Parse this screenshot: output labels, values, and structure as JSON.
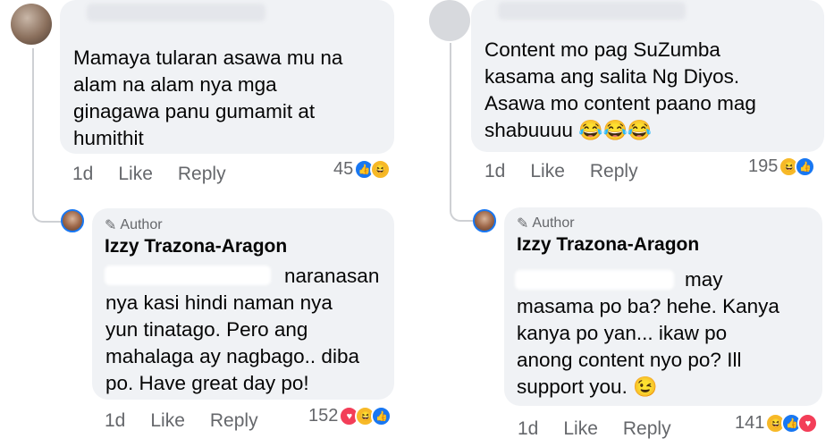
{
  "left": {
    "comment": {
      "lines": [
        "Mamaya tularan asawa mu na",
        "alam na alam nya mga",
        "ginagawa panu gumamit at",
        "humithit"
      ],
      "time": "1d",
      "like_label": "Like",
      "reply_label": "Reply",
      "reaction_count": "45"
    },
    "reply": {
      "badge": "Author",
      "name": "Izzy Trazona-Aragon",
      "lines": [
        "naranasan",
        "nya kasi hindi naman nya",
        "yun tinatago. Pero ang",
        "mahalaga ay nagbago.. diba",
        "po. Have great day po!"
      ],
      "time": "1d",
      "like_label": "Like",
      "reply_label": "Reply",
      "reaction_count": "152"
    }
  },
  "right": {
    "comment": {
      "lines": [
        "Content mo pag SuZumba",
        "kasama ang salita Ng Diyos.",
        "Asawa mo content paano mag",
        "shabuuuu"
      ],
      "emoji": "😂😂😂",
      "time": "1d",
      "like_label": "Like",
      "reply_label": "Reply",
      "reaction_count": "195"
    },
    "reply": {
      "badge": "Author",
      "name": "Izzy Trazona-Aragon",
      "lines": [
        "may",
        "masama po ba? hehe. Kanya",
        "kanya po yan... ikaw po",
        "anong content nyo po? Ill",
        "support you."
      ],
      "emoji": "😉",
      "time": "1d",
      "like_label": "Like",
      "reply_label": "Reply",
      "reaction_count": "141"
    }
  },
  "colors": {
    "bubble": "#f0f2f5",
    "meta_text": "#65676b",
    "like_blue": "#1877f2",
    "haha_yellow": "#f7b928",
    "heart_red": "#f33e58"
  }
}
